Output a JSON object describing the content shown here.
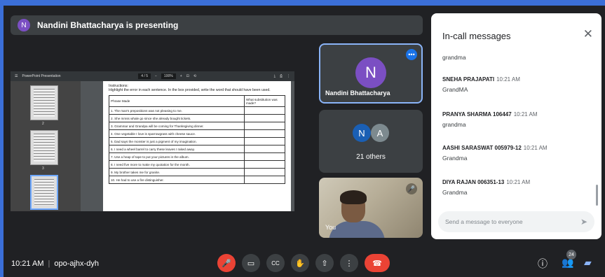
{
  "banner": {
    "avatar_letter": "N",
    "text": "Nandini Bhattacharya is presenting"
  },
  "presentation": {
    "toolbar": {
      "title": "PowerPoint Presentation",
      "page": "4 / 5",
      "zoom": "100%"
    },
    "thumb_numbers": [
      "2",
      "3",
      "4"
    ],
    "instructions": "Instructions:\nHighlight the error in each sentence. In the box provided, write the word that should have been used.",
    "table": {
      "headers": [
        "Phrase Made",
        "What substitution was made?"
      ],
      "rows": [
        "1. The man's prepositions was not pleasing to me.",
        "2. She mmss whale go since she already bought tickets.",
        "3. Grammar and Grandpa will be coming for Thanksgiving dinner.",
        "4. One vegetable I love is sparrowgrass with cheese sauce.",
        "5. Dad says the monster is just a pigment of my imagination.",
        "6. I need a wheel barrel to carry these leaves I raked away.",
        "7. Use a heap of tape to put your pictures in the album.",
        "8. I need five more to make my quotation for the month.",
        "9. My brother takes me for granite.",
        "10. He had to use a fire distinguisher."
      ]
    }
  },
  "tiles": {
    "presenter": {
      "letter": "N",
      "name": "Nandini Bhattacharya",
      "more_icon": "more-dots-icon"
    },
    "others": {
      "letters": [
        "N",
        "A"
      ],
      "label": "21 others"
    },
    "self": {
      "label": "You",
      "mic_icon": "mic-off-icon"
    }
  },
  "chat": {
    "title": "In-call messages",
    "messages": [
      {
        "sender": "",
        "time": "",
        "text": "grandma"
      },
      {
        "sender": "SNEHA PRAJAPATI",
        "time": "10:21 AM",
        "text": "GrandMA"
      },
      {
        "sender": "PRANYA SHARMA 106447",
        "time": "10:21 AM",
        "text": "grandma"
      },
      {
        "sender": "AASHI SARASWAT 005979-12",
        "time": "10:21 AM",
        "text": "Grandma"
      },
      {
        "sender": "DIYA RAJAN 006351-13",
        "time": "10:21 AM",
        "text": "Grandma"
      }
    ],
    "compose_placeholder": "Send a message to everyone"
  },
  "bottom": {
    "time": "10:21 AM",
    "meeting_code": "opo-ajhx-dyh",
    "participants_count": "24"
  },
  "colors": {
    "accent": "#1a73e8",
    "danger": "#ea4335",
    "bg": "#202124",
    "frame": "#3b6fd8"
  }
}
